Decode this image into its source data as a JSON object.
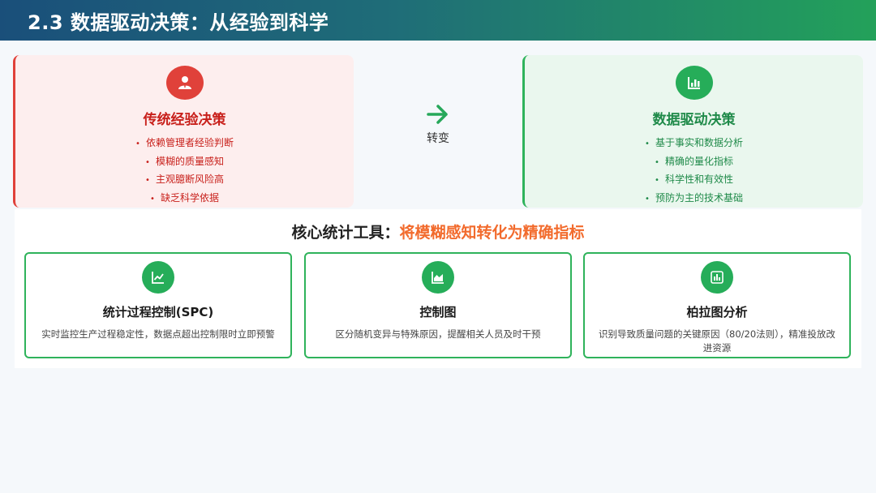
{
  "header": {
    "title": "2.3 数据驱动决策：从经验到科学"
  },
  "comparison": {
    "left": {
      "icon": "user-icon",
      "title": "传统经验决策",
      "bullets": [
        "依赖管理者经验判断",
        "模糊的质量感知",
        "主观臆断风险高",
        "缺乏科学依据"
      ],
      "accent": "#e0413a"
    },
    "transition": {
      "icon": "arrow-right-icon",
      "label": "转变"
    },
    "right": {
      "icon": "bar-chart-icon",
      "title": "数据驱动决策",
      "bullets": [
        "基于事实和数据分析",
        "精确的量化指标",
        "科学性和有效性",
        "预防为主的技术基础"
      ],
      "accent": "#2fb35b"
    }
  },
  "tools": {
    "heading_prefix": "核心统计工具：",
    "heading_emphasis": "将模糊感知转化为精确指标",
    "emphasis_color": "#f26b2d",
    "items": [
      {
        "icon": "line-chart-icon",
        "title": "统计过程控制(SPC)",
        "desc": "实时监控生产过程稳定性，数据点超出控制限时立即预警"
      },
      {
        "icon": "area-chart-icon",
        "title": "控制图",
        "desc": "区分随机变异与特殊原因，提醒相关人员及时干预"
      },
      {
        "icon": "column-chart-icon",
        "title": "柏拉图分析",
        "desc": "识别导致质量问题的关键原因（80/20法则），精准投放改进资源"
      }
    ]
  }
}
